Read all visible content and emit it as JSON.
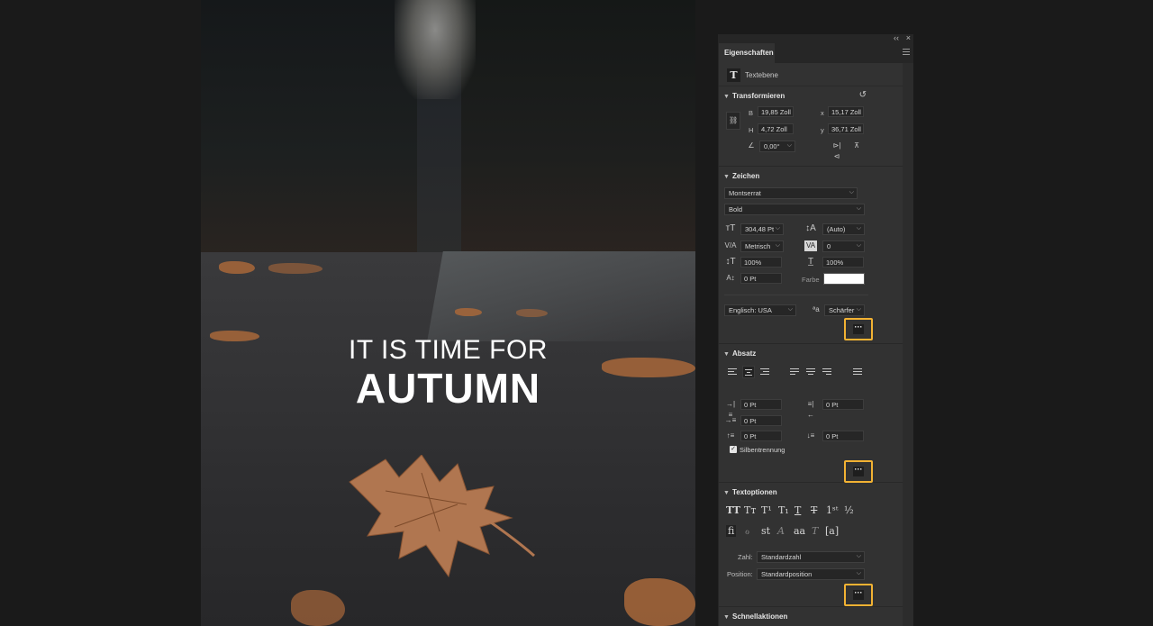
{
  "canvas": {
    "headline_line1": "IT IS TIME FOR",
    "headline_line2": "AUTUMN",
    "text_color": "#ffffff"
  },
  "panel": {
    "collapse_glyph": "‹‹",
    "close_glyph": "×",
    "tab_label": "Eigenschaften",
    "layer_type_icon": "T",
    "layer_label": "Textebene",
    "transform": {
      "title": "Transformieren",
      "w_label": "B",
      "w_value": "19,85 Zoll",
      "h_label": "H",
      "h_value": "4,72 Zoll",
      "x_label": "x",
      "x_value": "15,17 Zoll",
      "y_label": "y",
      "y_value": "36,71 Zoll",
      "angle_value": "0,00°"
    },
    "character": {
      "title": "Zeichen",
      "font_family": "Montserrat",
      "font_style": "Bold",
      "font_size": "304,48 Pt",
      "leading": "(Auto)",
      "kerning": "Metrisch",
      "tracking": "0",
      "vertical_scale": "100%",
      "horizontal_scale": "100%",
      "baseline_shift": "0 Pt",
      "color_label": "Farbe",
      "color_value": "#ffffff",
      "language": "Englisch: USA",
      "antialias": "Schärfer"
    },
    "paragraph": {
      "title": "Absatz",
      "indent_left": "0 Pt",
      "indent_right": "0 Pt",
      "indent_first": "0 Pt",
      "space_before": "0 Pt",
      "space_after": "0 Pt",
      "hyphenate_label": "Silbentrennung",
      "hyphenate_checked": true
    },
    "text_options": {
      "title": "Textoptionen",
      "number_label": "Zahl:",
      "number_value": "Standardzahl",
      "position_label": "Position:",
      "position_value": "Standardposition"
    },
    "quick_actions": {
      "title": "Schnellaktionen"
    },
    "more_button_label": "···",
    "highlight_color": "#f2b233"
  }
}
